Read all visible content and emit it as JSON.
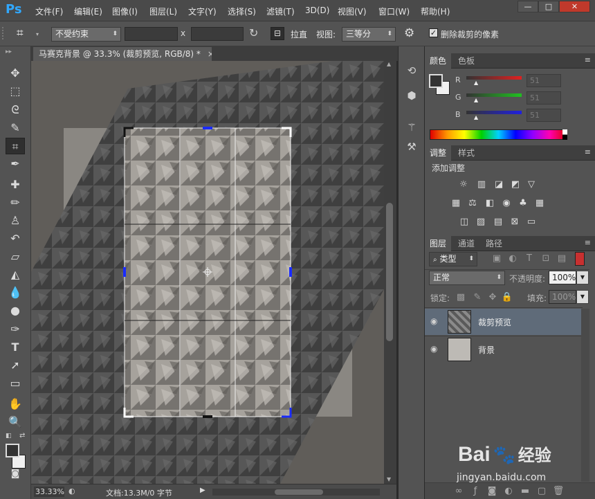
{
  "app": {
    "logo": "Ps"
  },
  "menu": [
    "文件(F)",
    "编辑(E)",
    "图像(I)",
    "图层(L)",
    "文字(Y)",
    "选择(S)",
    "滤镜(T)",
    "3D(D)",
    "视图(V)",
    "窗口(W)",
    "帮助(H)"
  ],
  "window_controls": {
    "minimize": "—",
    "maximize": "□",
    "close": "✕"
  },
  "options": {
    "ratio_select": "不受约束",
    "width_value": "",
    "x_label": "x",
    "height_value": "",
    "straighten_label": "拉直",
    "view_label": "视图:",
    "view_select": "三等分",
    "delete_cropped_label": "删除裁剪的像素",
    "delete_cropped_checked": true
  },
  "document": {
    "tab_title": "马赛克背景 @ 33.3% (裁剪预览, RGB/8) *",
    "close_glyph": "×"
  },
  "status": {
    "zoom": "33.33%",
    "doc_info": "文档:13.3M/0 字节"
  },
  "color_panel": {
    "tabs": [
      "颜色",
      "色板"
    ],
    "r_label": "R",
    "g_label": "G",
    "b_label": "B",
    "r": "51",
    "g": "51",
    "b": "51",
    "foreground": "#333333",
    "background": "#f0f0f0"
  },
  "adjust_panel": {
    "tabs": [
      "调整",
      "样式"
    ],
    "heading": "添加调整"
  },
  "layers_panel": {
    "tabs": [
      "图层",
      "通道",
      "路径"
    ],
    "filter_kind": "类型",
    "blend_mode": "正常",
    "opacity_label": "不透明度:",
    "opacity": "100%",
    "lock_label": "锁定:",
    "fill_label": "填充:",
    "fill": "100%",
    "layers": [
      {
        "name": "裁剪预览",
        "selected": true
      },
      {
        "name": "背景",
        "selected": false
      }
    ]
  },
  "watermark": {
    "brand": "Bai",
    "brand2": "经验",
    "url": "jingyan.baidu.com"
  }
}
